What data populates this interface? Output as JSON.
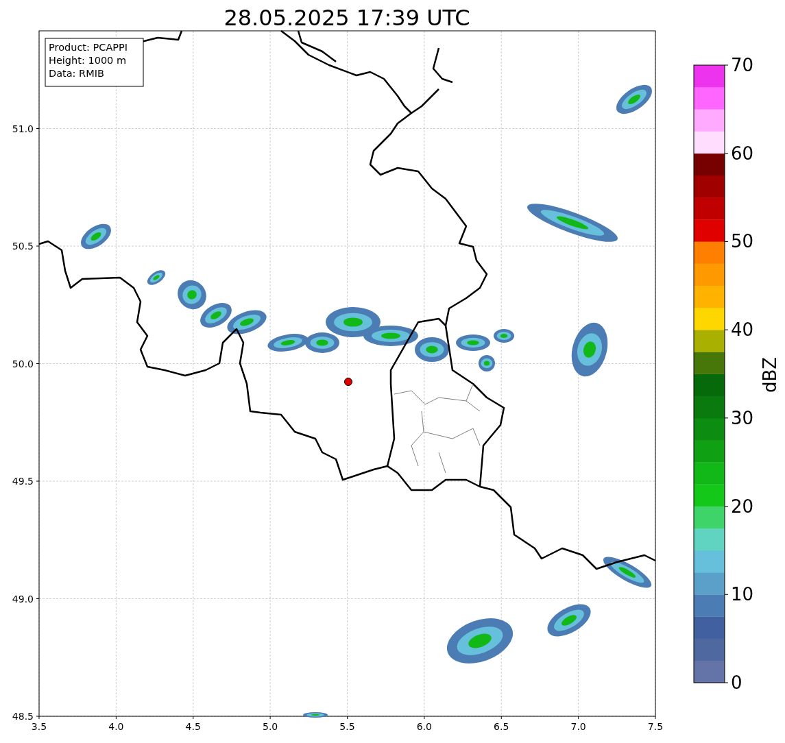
{
  "title": "28.05.2025 17:39 UTC",
  "info_box": [
    "Product: PCAPPI",
    "Height: 1000 m",
    "Data: RMIB"
  ],
  "x_ticks": [
    "3.5",
    "4.0",
    "4.5",
    "5.0",
    "5.5",
    "6.0",
    "6.5",
    "7.0",
    "7.5"
  ],
  "y_ticks": [
    "51.0",
    "50.5",
    "50.0",
    "49.5",
    "49.0",
    "48.5"
  ],
  "colorbar": {
    "label": "dBZ",
    "ticks": [
      "70",
      "60",
      "50",
      "40",
      "30",
      "20",
      "10",
      "0"
    ],
    "bins": [
      {
        "color": "#6474a8"
      },
      {
        "color": "#5068a0"
      },
      {
        "color": "#4060a0"
      },
      {
        "color": "#4c7cb4"
      },
      {
        "color": "#5ba0c8"
      },
      {
        "color": "#66c0dc"
      },
      {
        "color": "#60d4c0"
      },
      {
        "color": "#3ed46a"
      },
      {
        "color": "#14c81a"
      },
      {
        "color": "#12b818"
      },
      {
        "color": "#10a014"
      },
      {
        "color": "#0c8c10"
      },
      {
        "color": "#0a7a0e"
      },
      {
        "color": "#066a0a"
      },
      {
        "color": "#477708"
      },
      {
        "color": "#aab000"
      },
      {
        "color": "#ffd700"
      },
      {
        "color": "#ffb300"
      },
      {
        "color": "#ff9900"
      },
      {
        "color": "#ff7f00"
      },
      {
        "color": "#e00000"
      },
      {
        "color": "#c00000"
      },
      {
        "color": "#a00000"
      },
      {
        "color": "#770000"
      },
      {
        "color": "#ffddff"
      },
      {
        "color": "#ffaaff"
      },
      {
        "color": "#ff66ff"
      },
      {
        "color": "#ee33ee"
      }
    ]
  }
}
